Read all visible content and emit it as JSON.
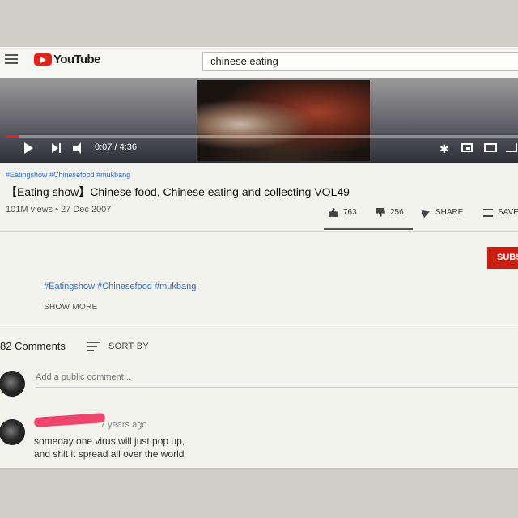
{
  "header": {
    "logo_text": "YouTube",
    "search_value": "chinese eating"
  },
  "player": {
    "time": "0:07 / 4:36",
    "progress": 0.025
  },
  "video": {
    "hashtags_top": "#Eatingshow #Chinesefood #mukbang",
    "title": "【Eating show】Chinese food, Chinese eating and collecting VOL49",
    "meta": "101M views • 27 Dec 2007",
    "likes": "763",
    "dislikes": "256",
    "share_label": "SHARE",
    "save_label": "SAVE"
  },
  "description": {
    "subscribe_label": "SUBS",
    "hashtags": "#Eatingshow #Chinesefood #mukbang",
    "show_more": "SHOW MORE"
  },
  "comments": {
    "count_label": "82 Comments",
    "sort_label": "SORT BY",
    "add_placeholder": "Add a public comment...",
    "items": [
      {
        "time": "7 years ago",
        "line1": "someday one virus will just pop up,",
        "line2": "and shit it spread all over the world"
      }
    ]
  },
  "colors": {
    "brand_red": "#e62117",
    "link_blue": "#2f6ad3",
    "redaction_pink": "#f0456a"
  }
}
